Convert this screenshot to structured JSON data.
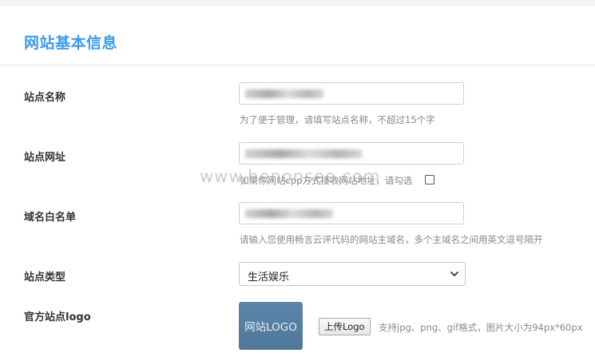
{
  "page_title": "网站基本信息",
  "site_name": {
    "label": "站点名称",
    "help": "为了便于管理，请填写站点名称，不超过15个字"
  },
  "site_url": {
    "label": "站点网址",
    "help": "如果你网站cpp方式接收网站地址，请勾选"
  },
  "domain_whitelist": {
    "label": "域名白名单",
    "help": "请输入您使用畅言云评代码的网站主域名，多个主域名之间用英文逗号隔开"
  },
  "site_type": {
    "label": "站点类型",
    "selected": "生活娱乐"
  },
  "site_logo": {
    "label": "官方站点logo",
    "preview_text": "网站LOGO",
    "upload_button": "上传Logo",
    "hint": "支持jpg、png、gif格式，图片大小为94px*60px"
  },
  "watermark": "www.henonsee.com",
  "icons": {
    "select_arrow": "chevron-down-icon"
  }
}
